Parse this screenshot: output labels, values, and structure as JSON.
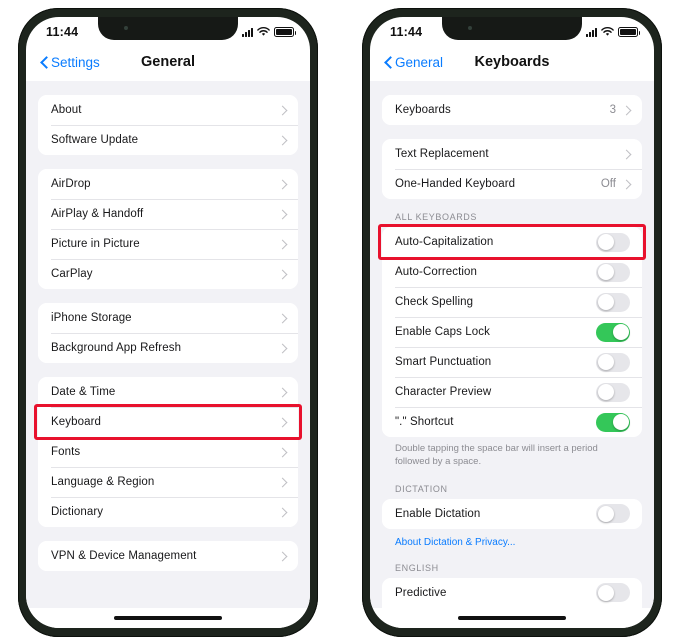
{
  "theme": {
    "accent_blue": "#0a7cff",
    "toggle_on_green": "#34c759",
    "highlight_red": "#e8112d",
    "group_bg": "#f2f2f6",
    "bezel": "#1d241d"
  },
  "phones": [
    {
      "id": "left",
      "status_bar": {
        "time": "11:44",
        "signal_icon": "cellular-bars-icon",
        "wifi_icon": "wifi-icon",
        "battery_icon": "battery-full-icon"
      },
      "nav": {
        "back_label": "Settings",
        "back_icon": "chevron-left-icon",
        "title": "General"
      },
      "groups": [
        {
          "rows": [
            {
              "label": "About",
              "accessory": "chevron"
            },
            {
              "label": "Software Update",
              "accessory": "chevron"
            }
          ]
        },
        {
          "rows": [
            {
              "label": "AirDrop",
              "accessory": "chevron"
            },
            {
              "label": "AirPlay & Handoff",
              "accessory": "chevron"
            },
            {
              "label": "Picture in Picture",
              "accessory": "chevron"
            },
            {
              "label": "CarPlay",
              "accessory": "chevron"
            }
          ]
        },
        {
          "rows": [
            {
              "label": "iPhone Storage",
              "accessory": "chevron"
            },
            {
              "label": "Background App Refresh",
              "accessory": "chevron"
            }
          ]
        },
        {
          "rows": [
            {
              "label": "Date & Time",
              "accessory": "chevron"
            },
            {
              "label": "Keyboard",
              "accessory": "chevron",
              "highlighted": true
            },
            {
              "label": "Fonts",
              "accessory": "chevron"
            },
            {
              "label": "Language & Region",
              "accessory": "chevron"
            },
            {
              "label": "Dictionary",
              "accessory": "chevron"
            }
          ]
        },
        {
          "rows": [
            {
              "label": "VPN & Device Management",
              "accessory": "chevron"
            }
          ]
        }
      ]
    },
    {
      "id": "right",
      "status_bar": {
        "time": "11:44",
        "signal_icon": "cellular-bars-icon",
        "wifi_icon": "wifi-icon",
        "battery_icon": "battery-full-icon"
      },
      "nav": {
        "back_label": "General",
        "back_icon": "chevron-left-icon",
        "title": "Keyboards"
      },
      "groups": [
        {
          "rows": [
            {
              "label": "Keyboards",
              "accessory": "chevron",
              "value": "3"
            }
          ]
        },
        {
          "rows": [
            {
              "label": "Text Replacement",
              "accessory": "chevron"
            },
            {
              "label": "One-Handed Keyboard",
              "accessory": "chevron",
              "value": "Off"
            }
          ]
        },
        {
          "header": "ALL KEYBOARDS",
          "rows": [
            {
              "label": "Auto-Capitalization",
              "accessory": "toggle",
              "toggle_on": false,
              "highlighted": true
            },
            {
              "label": "Auto-Correction",
              "accessory": "toggle",
              "toggle_on": false
            },
            {
              "label": "Check Spelling",
              "accessory": "toggle",
              "toggle_on": false
            },
            {
              "label": "Enable Caps Lock",
              "accessory": "toggle",
              "toggle_on": true
            },
            {
              "label": "Smart Punctuation",
              "accessory": "toggle",
              "toggle_on": false
            },
            {
              "label": "Character Preview",
              "accessory": "toggle",
              "toggle_on": false
            },
            {
              "label": "\".\" Shortcut",
              "accessory": "toggle",
              "toggle_on": true
            }
          ],
          "footer": "Double tapping the space bar will insert a period followed by a space."
        },
        {
          "header": "DICTATION",
          "rows": [
            {
              "label": "Enable Dictation",
              "accessory": "toggle",
              "toggle_on": false
            }
          ],
          "link": "About Dictation & Privacy..."
        },
        {
          "header": "ENGLISH",
          "rows": [
            {
              "label": "Predictive",
              "accessory": "toggle",
              "toggle_on": false
            },
            {
              "label": "",
              "accessory": "toggle",
              "toggle_on": true,
              "clipped": true
            }
          ]
        }
      ]
    }
  ]
}
